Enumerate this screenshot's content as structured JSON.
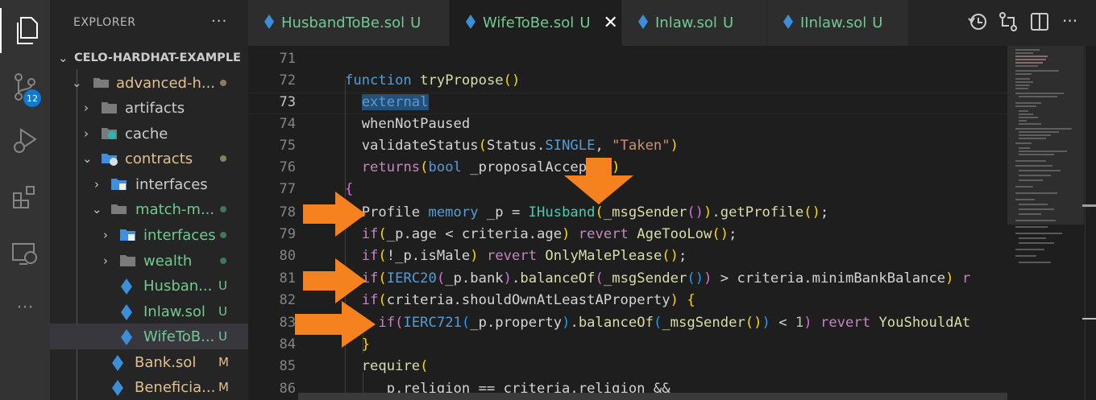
{
  "activity_bar": {
    "scm_badge": "12"
  },
  "sidebar": {
    "title": "EXPLORER",
    "more": "···",
    "tree": [
      {
        "label": "CELO-HARDHAT-EXAMPLE",
        "type": "root",
        "status": ""
      },
      {
        "label": "advanced-h...",
        "type": "folder-open",
        "status": "dot"
      },
      {
        "label": "artifacts",
        "type": "folder",
        "status": ""
      },
      {
        "label": "cache",
        "type": "folder",
        "status": ""
      },
      {
        "label": "contracts",
        "type": "folder-open",
        "status": "dot"
      },
      {
        "label": "interfaces",
        "type": "folder",
        "status": ""
      },
      {
        "label": "match-m...",
        "type": "folder-open",
        "status": "dot"
      },
      {
        "label": "interfaces",
        "type": "folder",
        "status": "dot"
      },
      {
        "label": "wealth",
        "type": "folder",
        "status": "dot"
      },
      {
        "label": "Husban...",
        "type": "file",
        "status": "U"
      },
      {
        "label": "Inlaw.sol",
        "type": "file",
        "status": "U"
      },
      {
        "label": "WifeToB...",
        "type": "file",
        "status": "U"
      },
      {
        "label": "Bank.sol",
        "type": "file",
        "status": "M"
      },
      {
        "label": "Beneficia...",
        "type": "file",
        "status": "M"
      }
    ]
  },
  "tabs": [
    {
      "label": "HusbandToBe.sol",
      "status": "U",
      "active": false
    },
    {
      "label": "WifeToBe.sol",
      "status": "U",
      "active": true,
      "close": "✕"
    },
    {
      "label": "Inlaw.sol",
      "status": "U",
      "active": false
    },
    {
      "label": "IInlaw.sol",
      "status": "U",
      "active": false
    }
  ],
  "editor": {
    "lines": [
      {
        "n": "71",
        "t": ""
      },
      {
        "n": "72",
        "t": "function tryPropose()"
      },
      {
        "n": "73",
        "t": "  external"
      },
      {
        "n": "74",
        "t": "  whenNotPaused"
      },
      {
        "n": "75",
        "t": "  validateStatus(Status.SINGLE, \"Taken\")"
      },
      {
        "n": "76",
        "t": "  returns(bool _proposalAccepted)"
      },
      {
        "n": "77",
        "t": "{"
      },
      {
        "n": "78",
        "t": "  Profile memory _p = IHusband(_msgSender()).getProfile();"
      },
      {
        "n": "79",
        "t": "  if(_p.age < criteria.age) revert AgeTooLow();"
      },
      {
        "n": "80",
        "t": "  if(!_p.isMale) revert OnlyMalePlease();"
      },
      {
        "n": "81",
        "t": "  if(IERC20(_p.bank).balanceOf(_msgSender()) > criteria.minimBankBalance) r"
      },
      {
        "n": "82",
        "t": "  if(criteria.shouldOwnAtLeastAProperty) {"
      },
      {
        "n": "83",
        "t": "    if(IERC721(_p.property).balanceOf(_msgSender()) < 1) revert YouShouldAt"
      },
      {
        "n": "84",
        "t": "  }"
      },
      {
        "n": "85",
        "t": "  require("
      },
      {
        "n": "86",
        "t": "    _p.religion == criteria.religion &&"
      }
    ]
  },
  "colors": {
    "activity_bar": "#333333",
    "sidebar": "#252526",
    "editor": "#1e1e1e",
    "untracked": "#73c991",
    "modified": "#e2c08d",
    "accent_arrow": "#f5821f"
  }
}
